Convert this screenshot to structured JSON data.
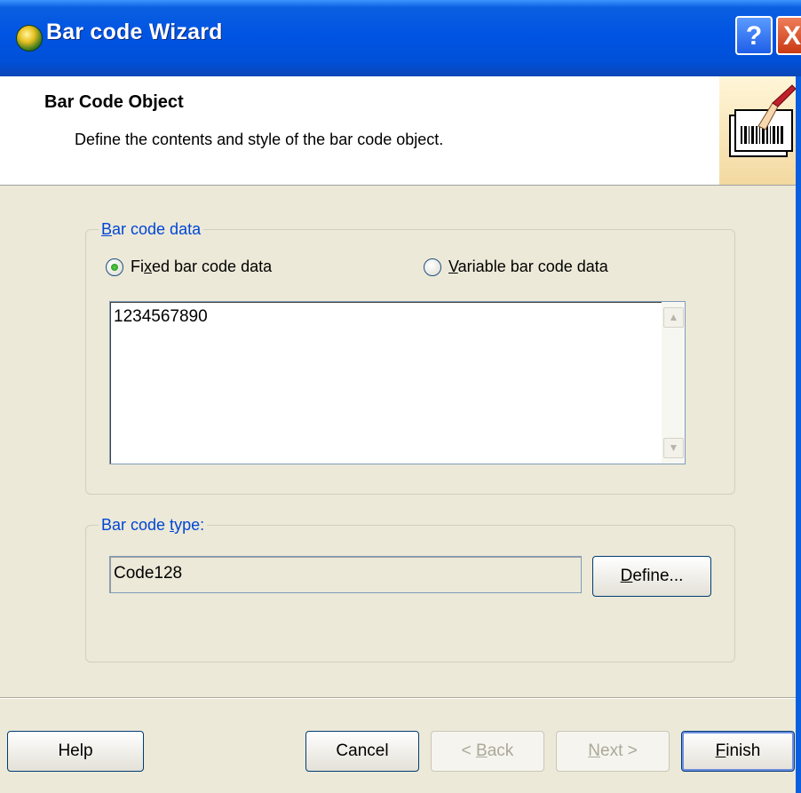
{
  "window": {
    "title": "Bar code Wizard",
    "help_glyph": "?",
    "close_glyph": "X"
  },
  "header": {
    "title": "Bar Code Object",
    "subtitle": "Define the contents and style of the bar code object.",
    "icon": "barcode-wizard-icon"
  },
  "bar_code_data": {
    "legend_pre": "",
    "legend_accel": "B",
    "legend_rest": "ar code data",
    "fixed_radio": {
      "pre": "Fi",
      "accel": "x",
      "rest": "ed bar code data",
      "checked": true
    },
    "variable_radio": {
      "pre": "",
      "accel": "V",
      "rest": "ariable bar code data",
      "checked": false
    },
    "value": "1234567890"
  },
  "bar_code_type": {
    "legend_pre": "Bar code ",
    "legend_accel": "t",
    "legend_rest": "ype:",
    "value": "Code128",
    "define_button": {
      "accel": "D",
      "rest": "efine..."
    }
  },
  "footer": {
    "help": "Help",
    "cancel": "Cancel",
    "back": {
      "pre": "< ",
      "accel": "B",
      "rest": "ack"
    },
    "next": {
      "accel": "N",
      "rest": "ext >"
    },
    "finish": {
      "accel": "F",
      "rest": "inish"
    }
  },
  "colors": {
    "titlebar": "#0054e3",
    "face": "#ece9d8",
    "legend": "#0046d5",
    "radio_on": "#1f8a1a"
  }
}
